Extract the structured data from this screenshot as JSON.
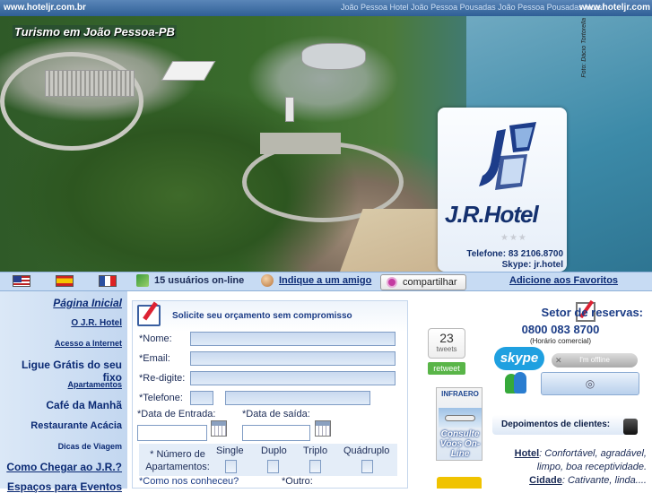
{
  "topbar": {
    "site_url": "www.hoteljr.com.br",
    "marquee": "João Pessoa Hotel João Pessoa Pousadas João Pessoa Pousadas Hotel",
    "site_url_right": "www.hoteljr.com"
  },
  "banner": {
    "title": "Turismo em João Pessoa-PB",
    "photo_credit": "Foto: Dácio Tortorella",
    "logo_name": "J.R.Hotel",
    "logo_stars": "★★★",
    "phone": "Telefone: 83 2106.8700",
    "skype": "Skype: jr.hotel"
  },
  "toolbar": {
    "users_online": "15 usuários on-line",
    "indique": "Indique a um amigo",
    "share": "compartilhar",
    "favoritos": "Adicione aos Favoritos"
  },
  "nav": {
    "items": [
      "Página Inicial",
      "O J.R. Hotel",
      "Acesso a Internet",
      "Ligue Grátis do seu fixo",
      "Apartamentos",
      "Café da Manhã",
      "Restaurante Acácia",
      "Dicas de Viagem",
      "Como Chegar ao J.R.?",
      "Espaços para Eventos"
    ]
  },
  "form": {
    "title": "Solicite seu orçamento sem compromisso",
    "name_label": "*Nome:",
    "email_label": "*Email:",
    "redigite_label": "*Re-digite:",
    "phone_label": "*Telefone:",
    "checkin_label": "*Data de Entrada:",
    "checkout_label": "*Data de saída:",
    "rooms_label": "* Número de Apartamentos:",
    "room_types": [
      "Single",
      "Duplo",
      "Triplo",
      "Quádruplo"
    ],
    "how_label": "*Como nos conheceu?",
    "other_label": "*Outro:"
  },
  "tweets": {
    "count": "23",
    "label": "tweets",
    "retweet": "retweet"
  },
  "infraero": {
    "title": "INFRAERO",
    "text": "Consulte Vôos On-Line"
  },
  "reservas": {
    "title": "Setor de reservas:",
    "phone": "0800 083 8700",
    "note": "(Horário comercial)",
    "skype_label": "skype",
    "status": "I'm offline"
  },
  "depoimentos": {
    "title": "Depoimentos de clientes:",
    "line1_key": "Hotel",
    "line1_text": ": Confortável, agradável, limpo, boa receptividade.",
    "line2_key": "Cidade",
    "line2_text": ": Cativante, linda...."
  },
  "colors": {
    "nav_link": "#0b2a74",
    "brand_blue": "#14306e",
    "toolbar_bg": "#c7dbf3"
  }
}
